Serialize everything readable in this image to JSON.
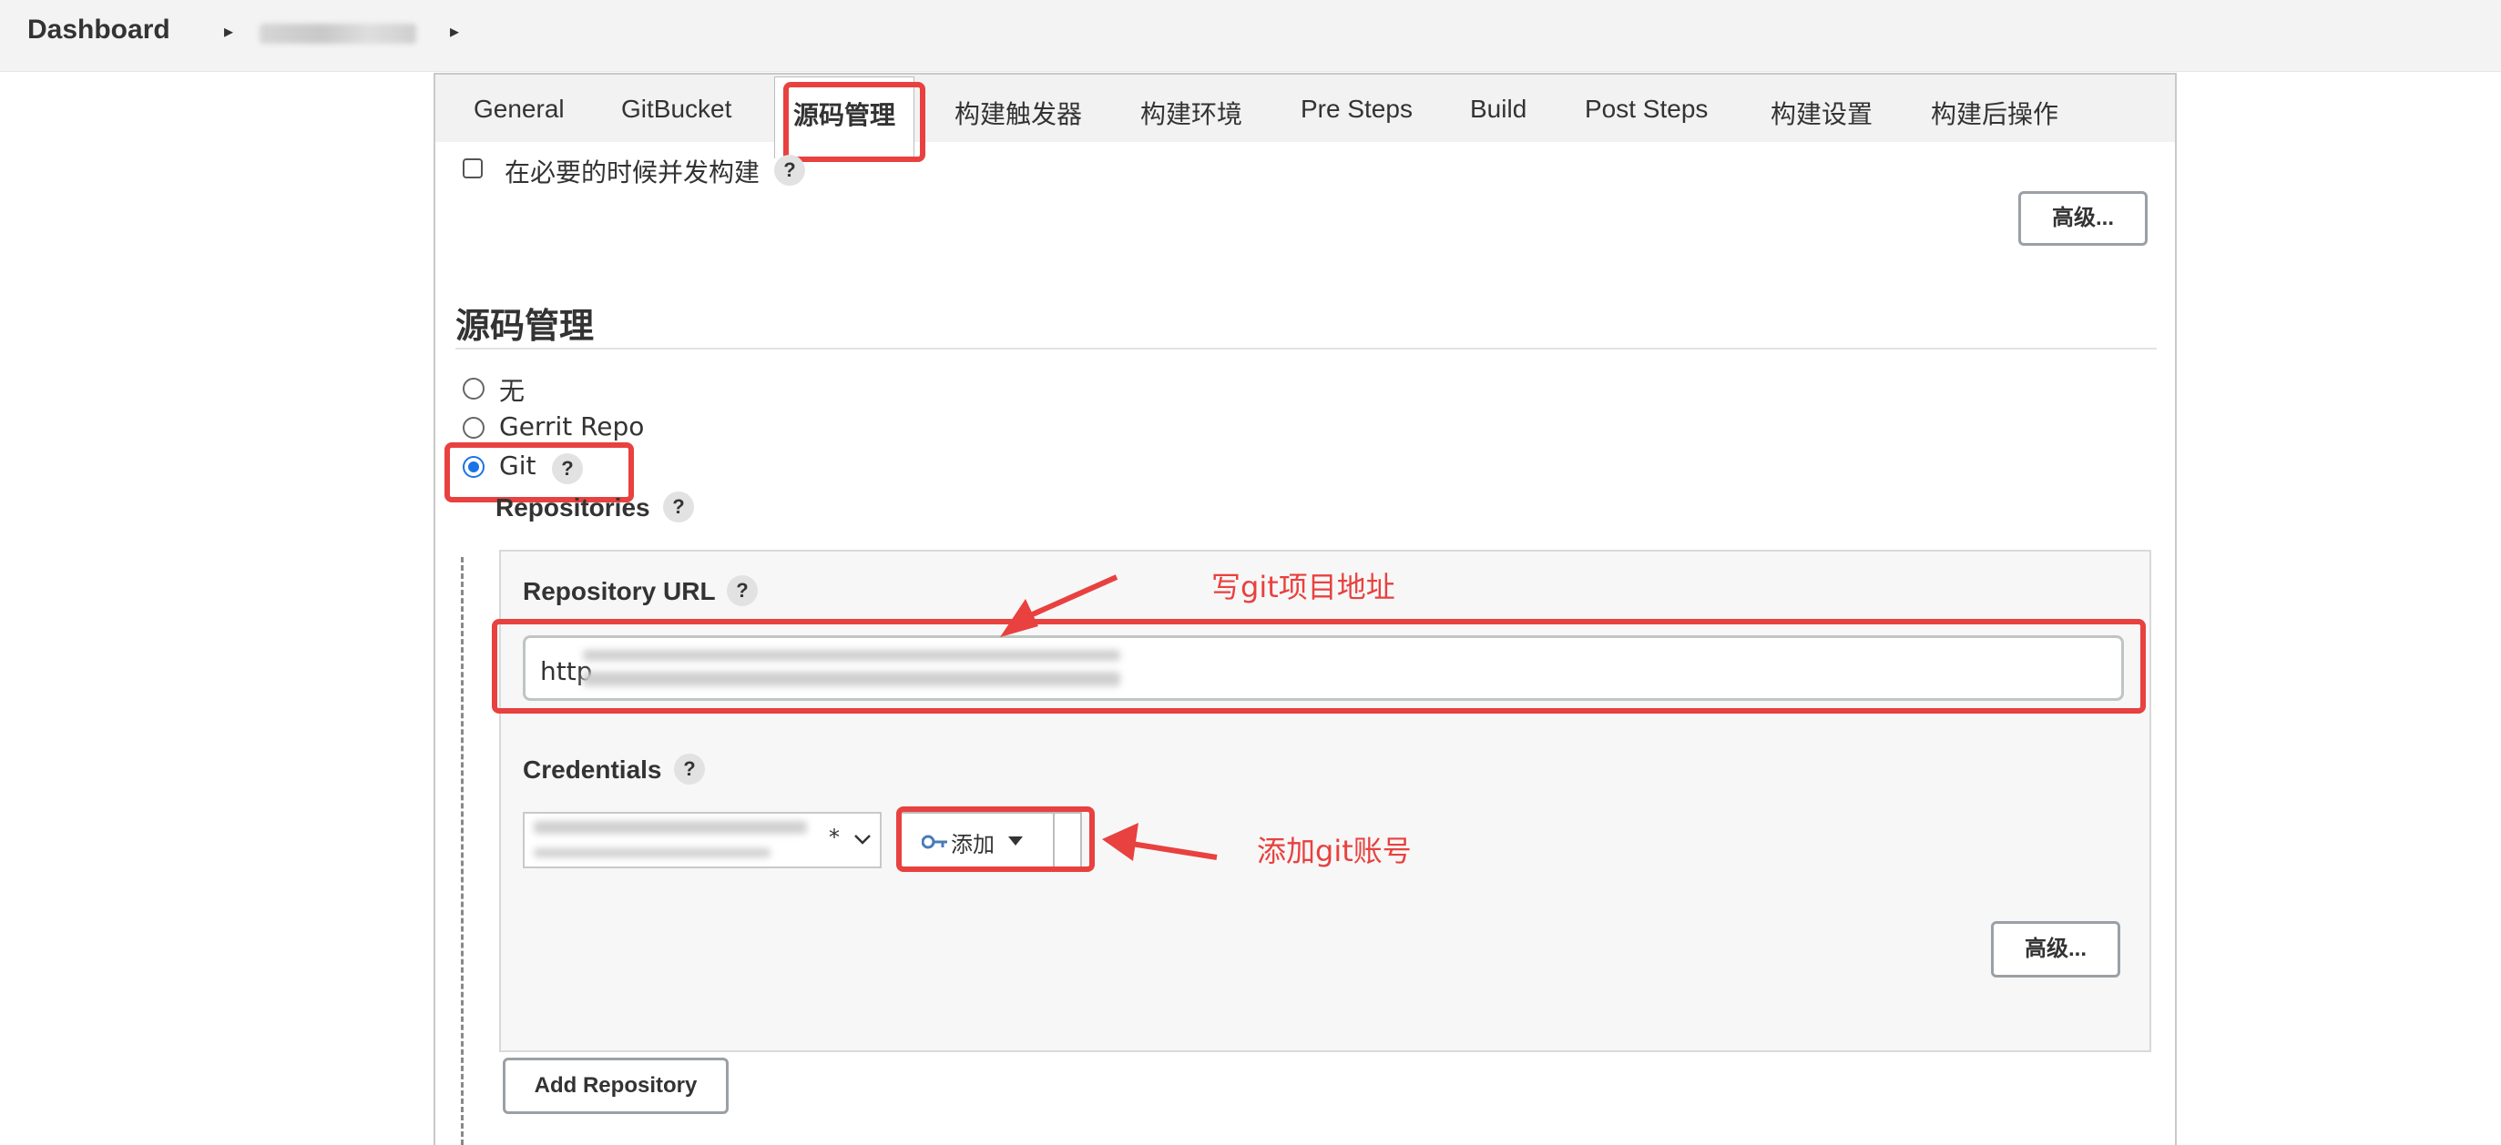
{
  "breadcrumb": {
    "dashboard": "Dashboard",
    "separator": "▸"
  },
  "tabs": [
    {
      "label": "General",
      "active": false
    },
    {
      "label": "GitBucket",
      "active": false
    },
    {
      "label": "源码管理",
      "active": true
    },
    {
      "label": "构建触发器",
      "active": false
    },
    {
      "label": "构建环境",
      "active": false
    },
    {
      "label": "Pre Steps",
      "active": false
    },
    {
      "label": "Build",
      "active": false
    },
    {
      "label": "Post Steps",
      "active": false
    },
    {
      "label": "构建设置",
      "active": false
    },
    {
      "label": "构建后操作",
      "active": false
    }
  ],
  "general": {
    "concurrent_build_label": "在必要的时候并发构建",
    "advanced_button": "高级..."
  },
  "scm": {
    "title": "源码管理",
    "options": [
      {
        "label": "无",
        "checked": false
      },
      {
        "label": "Gerrit Repo",
        "checked": false
      },
      {
        "label": "Git",
        "checked": true
      }
    ],
    "repositories_label": "Repositories",
    "repository_url_label": "Repository URL",
    "repository_url_value": "http",
    "credentials_label": "Credentials",
    "credentials_selected_suffix": "*",
    "add_button": "添加",
    "advanced_button": "高级...",
    "add_repository_button": "Add Repository"
  },
  "help_symbol": "?",
  "annotations": {
    "url_note": "写git项目地址",
    "credentials_note": "添加git账号",
    "color": "#e8413f"
  },
  "colors": {
    "accent": "#1a73e8",
    "annotation": "#e8413f"
  }
}
